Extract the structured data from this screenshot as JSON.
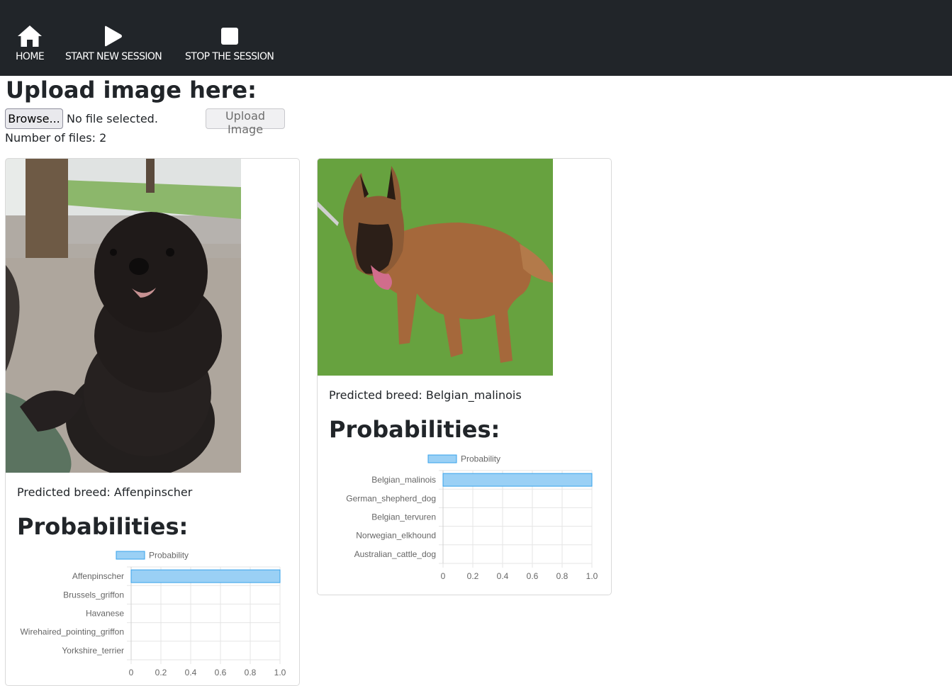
{
  "nav": {
    "home_label": "HOME",
    "start_label": "START NEW SESSION",
    "stop_label": "STOP THE SESSION"
  },
  "page": {
    "title": "Upload image here:",
    "browse_label": "Browse...",
    "file_status": "No file selected.",
    "upload_label": "Upload Image",
    "files_count_label": "Number of files:",
    "files_count": "2"
  },
  "colors": {
    "navbar": "#212529",
    "bar_fill": "#9ad0f5",
    "bar_border": "#36a2eb"
  },
  "results": [
    {
      "breed_label": "Predicted breed: Affenpinscher",
      "prob_title": "Probabilities:",
      "legend_label": "Probability",
      "chart_data": {
        "type": "bar",
        "orientation": "horizontal",
        "categories": [
          "Affenpinscher",
          "Brussels_griffon",
          "Havanese",
          "Wirehaired_pointing_griffon",
          "Yorkshire_terrier"
        ],
        "series": [
          {
            "name": "Probability",
            "values": [
              1.0,
              0.0,
              0.0,
              0.0,
              0.0
            ]
          }
        ],
        "xlim": [
          0,
          1.0
        ],
        "x_ticks": [
          "0",
          "0.2",
          "0.4",
          "0.6",
          "0.8",
          "1.0"
        ],
        "grid": true,
        "legend": "top"
      }
    },
    {
      "breed_label": "Predicted breed: Belgian_malinois",
      "prob_title": "Probabilities:",
      "legend_label": "Probability",
      "chart_data": {
        "type": "bar",
        "orientation": "horizontal",
        "categories": [
          "Belgian_malinois",
          "German_shepherd_dog",
          "Belgian_tervuren",
          "Norwegian_elkhound",
          "Australian_cattle_dog"
        ],
        "series": [
          {
            "name": "Probability",
            "values": [
              1.0,
              0.0,
              0.0,
              0.0,
              0.0
            ]
          }
        ],
        "xlim": [
          0,
          1.0
        ],
        "x_ticks": [
          "0",
          "0.2",
          "0.4",
          "0.6",
          "0.8",
          "1.0"
        ],
        "grid": true,
        "legend": "top"
      }
    }
  ]
}
